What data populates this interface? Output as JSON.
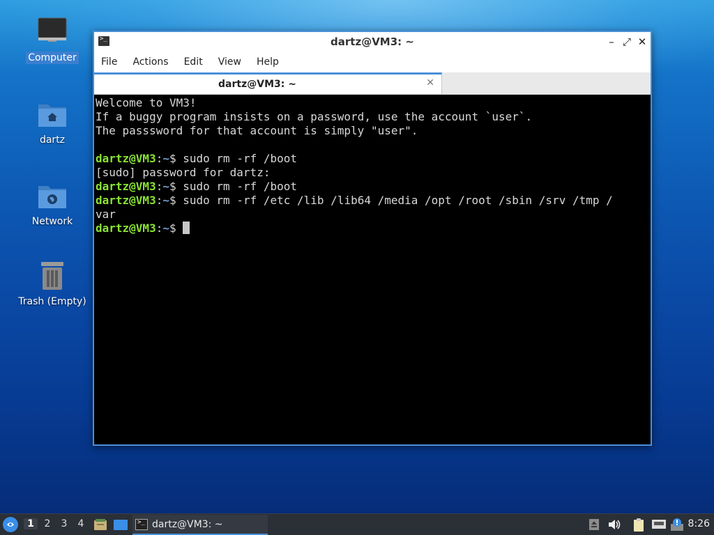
{
  "desktop": {
    "icons": [
      {
        "label": "Computer",
        "icon": "computer-icon"
      },
      {
        "label": "dartz",
        "icon": "home-folder-icon"
      },
      {
        "label": "Network",
        "icon": "network-folder-icon"
      },
      {
        "label": "Trash (Empty)",
        "icon": "trash-icon"
      }
    ]
  },
  "window": {
    "title": "dartz@VM3: ~",
    "menu": [
      "File",
      "Actions",
      "Edit",
      "View",
      "Help"
    ],
    "tab_label": "dartz@VM3: ~",
    "controls": {
      "minimize": "–",
      "maximize": "⤢",
      "close": "✕"
    }
  },
  "terminal": {
    "welcome": [
      "Welcome to VM3!",
      "If a buggy program insists on a password, use the account `user`.",
      "The passsword for that account is simply \"user\"."
    ],
    "prompt_user": "dartz@VM3",
    "prompt_path": "~",
    "prompt_sep": ":",
    "prompt_symbol": "$",
    "lines": [
      {
        "type": "cmd",
        "text": " sudo rm -rf /boot"
      },
      {
        "type": "out",
        "text": "[sudo] password for dartz:"
      },
      {
        "type": "cmd",
        "text": " sudo rm -rf /boot"
      },
      {
        "type": "cmd",
        "text": " sudo rm -rf /etc /lib /lib64 /media /opt /root /sbin /srv /tmp /"
      },
      {
        "type": "out",
        "text": "var"
      },
      {
        "type": "cmd",
        "text": " "
      }
    ]
  },
  "taskbar": {
    "workspaces": [
      "1",
      "2",
      "3",
      "4"
    ],
    "active_workspace": "1",
    "task_label": "dartz@VM3: ~",
    "clock": "8:26"
  },
  "colors": {
    "accent": "#4a90d9",
    "prompt_user": "#8ae234",
    "prompt_path": "#729fcf"
  }
}
